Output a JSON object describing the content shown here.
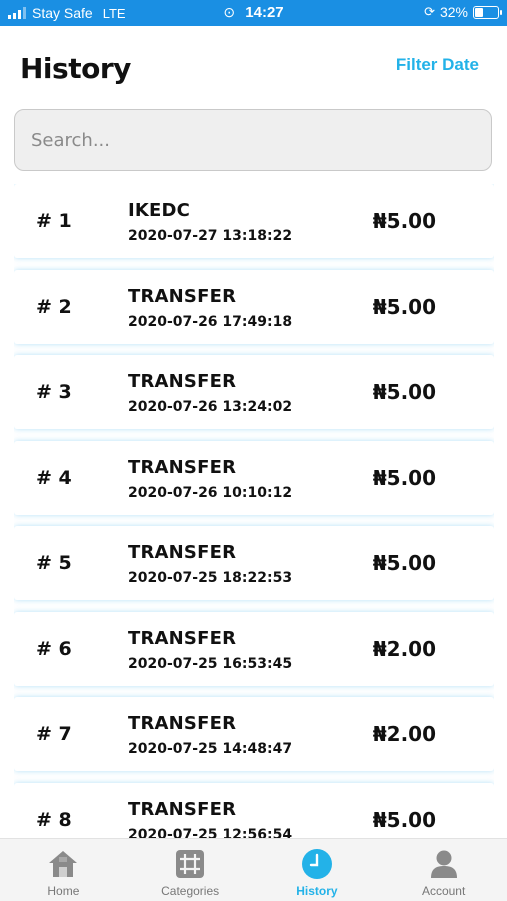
{
  "status_bar": {
    "carrier": "Stay Safe",
    "network": "LTE",
    "time": "14:27",
    "battery": "32%",
    "battery_level": 0.32
  },
  "header": {
    "title": "History",
    "filter_label": "Filter Date"
  },
  "search": {
    "placeholder": "Search..."
  },
  "transactions": [
    {
      "num": "# 1",
      "name": "IKEDC",
      "date": "2020-07-27 13:18:22",
      "amount": "₦5.00"
    },
    {
      "num": "# 2",
      "name": "TRANSFER",
      "date": "2020-07-26 17:49:18",
      "amount": "₦5.00"
    },
    {
      "num": "# 3",
      "name": "TRANSFER",
      "date": "2020-07-26 13:24:02",
      "amount": "₦5.00"
    },
    {
      "num": "# 4",
      "name": "TRANSFER",
      "date": "2020-07-26 10:10:12",
      "amount": "₦5.00"
    },
    {
      "num": "# 5",
      "name": "TRANSFER",
      "date": "2020-07-25 18:22:53",
      "amount": "₦5.00"
    },
    {
      "num": "# 6",
      "name": "TRANSFER",
      "date": "2020-07-25 16:53:45",
      "amount": "₦2.00"
    },
    {
      "num": "# 7",
      "name": "TRANSFER",
      "date": "2020-07-25 14:48:47",
      "amount": "₦2.00"
    },
    {
      "num": "# 8",
      "name": "TRANSFER",
      "date": "2020-07-25 12:56:54",
      "amount": "₦5.00"
    }
  ],
  "bottom_nav": {
    "items": [
      {
        "label": "Home",
        "icon": "home-icon"
      },
      {
        "label": "Categories",
        "icon": "grid-icon"
      },
      {
        "label": "History",
        "icon": "clock-icon",
        "active": true
      },
      {
        "label": "Account",
        "icon": "person-icon"
      }
    ]
  },
  "colors": {
    "status_bar": "#1a8fe3",
    "accent": "#23b2e8",
    "nav_inactive": "#777777"
  }
}
